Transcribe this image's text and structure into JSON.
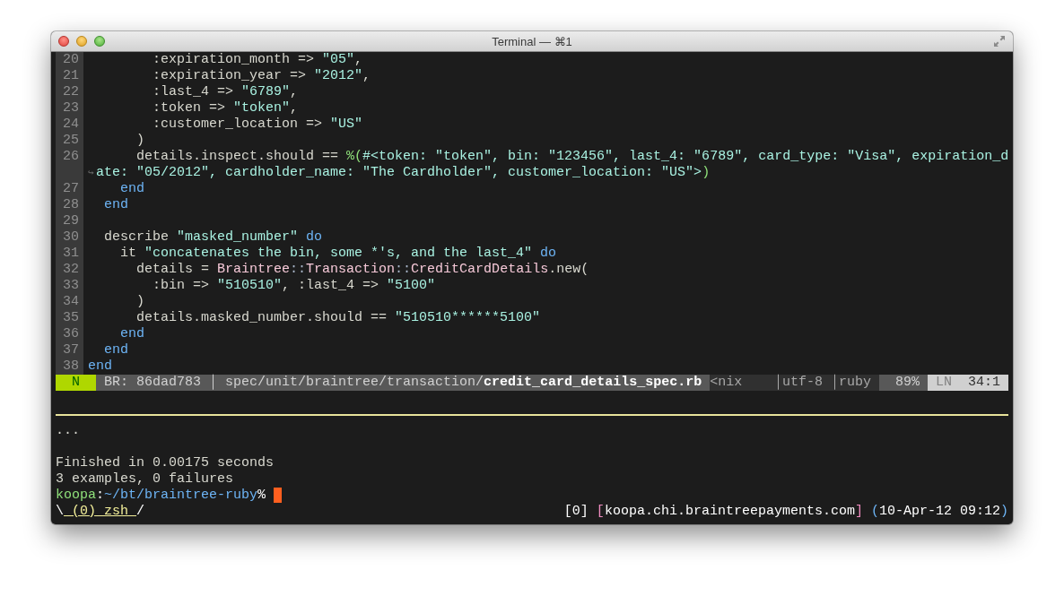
{
  "window": {
    "title": "Terminal — ⌘1"
  },
  "editor": {
    "lines": [
      {
        "kind": "line",
        "number": "20",
        "segments": [
          {
            "text": "        :expiration_month => ",
            "kind": "plain"
          },
          {
            "text": "\"05\"",
            "kind": "string"
          },
          {
            "text": ",",
            "kind": "plain"
          }
        ]
      },
      {
        "kind": "line",
        "number": "21",
        "segments": [
          {
            "text": "        :expiration_year => ",
            "kind": "plain"
          },
          {
            "text": "\"2012\"",
            "kind": "string"
          },
          {
            "text": ",",
            "kind": "plain"
          }
        ]
      },
      {
        "kind": "line",
        "number": "22",
        "segments": [
          {
            "text": "        :last_4 => ",
            "kind": "plain"
          },
          {
            "text": "\"6789\"",
            "kind": "string"
          },
          {
            "text": ",",
            "kind": "plain"
          }
        ]
      },
      {
        "kind": "line",
        "number": "23",
        "segments": [
          {
            "text": "        :token => ",
            "kind": "plain"
          },
          {
            "text": "\"token\"",
            "kind": "string"
          },
          {
            "text": ",",
            "kind": "plain"
          }
        ]
      },
      {
        "kind": "line",
        "number": "24",
        "segments": [
          {
            "text": "        :customer_location => ",
            "kind": "plain"
          },
          {
            "text": "\"US\"",
            "kind": "string"
          }
        ]
      },
      {
        "kind": "line",
        "number": "25",
        "segments": [
          {
            "text": "      )",
            "kind": "plain"
          }
        ]
      },
      {
        "kind": "line",
        "number": "26",
        "segments": [
          {
            "text": "      details.inspect.should == ",
            "kind": "plain"
          },
          {
            "text": "%(",
            "kind": "literal"
          },
          {
            "text": "#<token: \"token\", bin: \"123456\", last_4: \"6789\", card_type: \"Visa\", expiration_d",
            "kind": "string"
          }
        ]
      },
      {
        "kind": "wrap",
        "mark": "↪",
        "segments": [
          {
            "text": "ate: \"05/2012\", cardholder_name: \"The Cardholder\", customer_location: \"US\">",
            "kind": "string"
          },
          {
            "text": ")",
            "kind": "literal"
          }
        ]
      },
      {
        "kind": "line",
        "number": "27",
        "segments": [
          {
            "text": "    end",
            "kind": "keyword"
          }
        ]
      },
      {
        "kind": "line",
        "number": "28",
        "segments": [
          {
            "text": "  end",
            "kind": "keyword"
          }
        ]
      },
      {
        "kind": "line",
        "number": "29"
      },
      {
        "kind": "line",
        "number": "30",
        "segments": [
          {
            "text": "  describe ",
            "kind": "plain"
          },
          {
            "text": "\"masked_number\"",
            "kind": "string"
          },
          {
            "text": " do",
            "kind": "keyword"
          }
        ]
      },
      {
        "kind": "line",
        "number": "31",
        "segments": [
          {
            "text": "    it ",
            "kind": "plain"
          },
          {
            "text": "\"concatenates the bin, some *'s, and the last_4\"",
            "kind": "string"
          },
          {
            "text": " do",
            "kind": "keyword"
          }
        ]
      },
      {
        "kind": "line",
        "number": "32",
        "segments": [
          {
            "text": "      details = ",
            "kind": "plain"
          },
          {
            "text": "Braintree",
            "kind": "constant"
          },
          {
            "text": "::",
            "kind": "operator"
          },
          {
            "text": "Transaction",
            "kind": "constant"
          },
          {
            "text": "::",
            "kind": "operator"
          },
          {
            "text": "CreditCardDetails",
            "kind": "constant"
          },
          {
            "text": ".new(",
            "kind": "plain"
          }
        ]
      },
      {
        "kind": "line",
        "number": "33",
        "segments": [
          {
            "text": "        :bin => ",
            "kind": "plain"
          },
          {
            "text": "\"510510\"",
            "kind": "string"
          },
          {
            "text": ", :last_4 => ",
            "kind": "plain"
          },
          {
            "text": "\"5100\"",
            "kind": "string"
          }
        ]
      },
      {
        "kind": "line",
        "number": "34",
        "segments": [
          {
            "text": "      )",
            "kind": "plain"
          }
        ]
      },
      {
        "kind": "line",
        "number": "35",
        "segments": [
          {
            "text": "      details.masked_number.should == ",
            "kind": "plain"
          },
          {
            "text": "\"510510******5100\"",
            "kind": "string"
          }
        ]
      },
      {
        "kind": "line",
        "number": "36",
        "segments": [
          {
            "text": "    end",
            "kind": "keyword"
          }
        ]
      },
      {
        "kind": "line",
        "number": "37",
        "segments": [
          {
            "text": "  end",
            "kind": "keyword"
          }
        ]
      },
      {
        "kind": "line",
        "number": "38",
        "segments": [
          {
            "text": "end",
            "kind": "keyword"
          }
        ]
      }
    ]
  },
  "status_line": {
    "left": [
      {
        "text": "N",
        "kind": "mode"
      },
      {
        "text": "BR: 86dad783",
        "kind": "branch"
      },
      {
        "text": "│",
        "kind": "divider"
      },
      {
        "text": "spec/unit/braintree/transaction/",
        "kind": "path"
      },
      {
        "text": "credit_card_details_spec.rb",
        "kind": "file"
      },
      {
        "text": "<nix",
        "kind": "info"
      }
    ],
    "right": [
      {
        "text": "│",
        "kind": "divider_dark"
      },
      {
        "text": "utf-8",
        "kind": "info"
      },
      {
        "text": "│",
        "kind": "divider_dark"
      },
      {
        "text": "ruby",
        "kind": "info"
      },
      {
        "text": "89%",
        "kind": "percent"
      },
      {
        "text": "LN",
        "kind": "position_label"
      },
      {
        "text": "34:1",
        "kind": "position"
      }
    ]
  },
  "output": {
    "progress": "...",
    "summary": [
      "Finished in 0.00175 seconds",
      "3 examples, 0 failures"
    ]
  },
  "prompt": {
    "segments": [
      {
        "text": "koopa",
        "kind": "host"
      },
      {
        "text": ":",
        "kind": "plain"
      },
      {
        "text": "~/bt/braintree-ruby",
        "kind": "path"
      },
      {
        "text": "%",
        "kind": "plain"
      }
    ]
  },
  "tmux": {
    "window": {
      "segments": [
        {
          "text": "\\",
          "kind": "plain"
        },
        {
          "text": " (0) zsh ",
          "kind": "active"
        },
        {
          "text": "/",
          "kind": "plain"
        }
      ]
    },
    "right": [
      {
        "segments": [
          {
            "text": "[0]",
            "kind": "plain"
          }
        ]
      },
      {
        "segments": [
          {
            "text": "[",
            "kind": "bracket"
          },
          {
            "text": "koopa.chi.braintreepayments.com",
            "kind": "plain"
          },
          {
            "text": "]",
            "kind": "bracket"
          }
        ]
      },
      {
        "segments": [
          {
            "text": "(",
            "kind": "paren"
          },
          {
            "text": "10-Apr-12 09:12",
            "kind": "plain"
          },
          {
            "text": ")",
            "kind": "paren"
          }
        ]
      }
    ]
  }
}
